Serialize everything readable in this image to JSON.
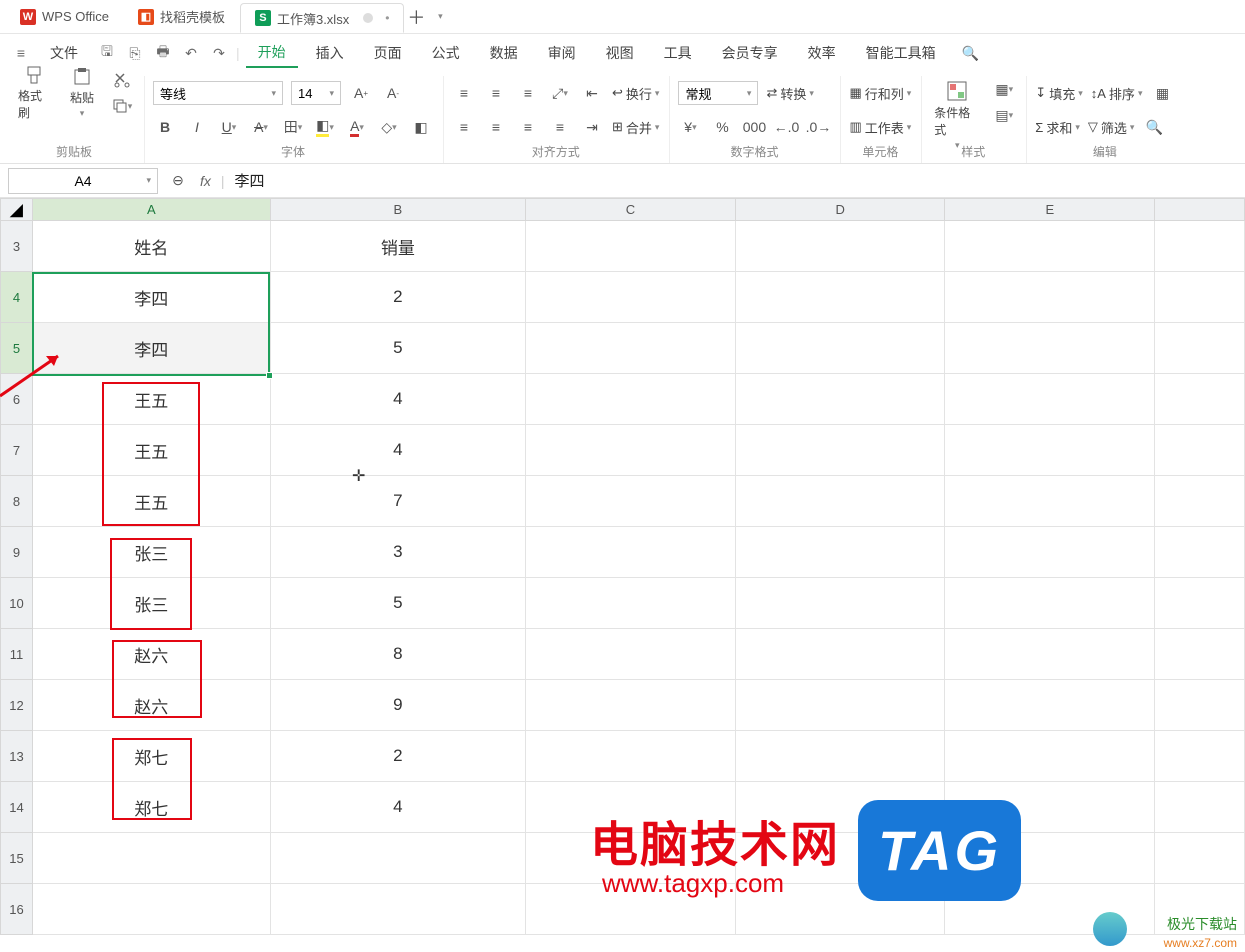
{
  "tabs": {
    "app": "WPS Office",
    "template": "找稻壳模板",
    "file": "工作簿3.xlsx",
    "new": "＋"
  },
  "menu": {
    "hamburger": "≡",
    "file": "文件",
    "items": [
      "开始",
      "插入",
      "页面",
      "公式",
      "数据",
      "审阅",
      "视图",
      "工具",
      "会员专享",
      "效率",
      "智能工具箱"
    ]
  },
  "ribbon": {
    "clipboard": {
      "formatpainter": "格式刷",
      "paste": "粘贴",
      "name": "剪贴板"
    },
    "font": {
      "name_sel": "等线",
      "size_sel": "14",
      "name": "字体"
    },
    "align": {
      "wrap": "换行",
      "merge": "合并",
      "name": "对齐方式"
    },
    "number": {
      "general": "常规",
      "convert": "转换",
      "name": "数字格式"
    },
    "cell": {
      "rowcol": "行和列",
      "sheet": "工作表",
      "name": "单元格"
    },
    "style": {
      "cond": "条件格式",
      "name": "样式"
    },
    "edit": {
      "fill": "填充",
      "sum": "求和",
      "sort": "排序",
      "filter": "筛选",
      "name": "编辑"
    }
  },
  "namebox": "A4",
  "fx": {
    "symbol": "fx",
    "value": "李四"
  },
  "columns": [
    "A",
    "B",
    "C",
    "D",
    "E"
  ],
  "rows": [
    {
      "n": "3",
      "a": "姓名",
      "b": "销量"
    },
    {
      "n": "4",
      "a": "李四",
      "b": "2"
    },
    {
      "n": "5",
      "a": "李四",
      "b": "5"
    },
    {
      "n": "6",
      "a": "王五",
      "b": "4"
    },
    {
      "n": "7",
      "a": "王五",
      "b": "4"
    },
    {
      "n": "8",
      "a": "王五",
      "b": "7"
    },
    {
      "n": "9",
      "a": "张三",
      "b": "3"
    },
    {
      "n": "10",
      "a": "张三",
      "b": "5"
    },
    {
      "n": "11",
      "a": "赵六",
      "b": "8"
    },
    {
      "n": "12",
      "a": "赵六",
      "b": "9"
    },
    {
      "n": "13",
      "a": "郑七",
      "b": "2"
    },
    {
      "n": "14",
      "a": "郑七",
      "b": "4"
    },
    {
      "n": "15",
      "a": "",
      "b": ""
    },
    {
      "n": "16",
      "a": "",
      "b": ""
    }
  ],
  "watermarks": {
    "tagxp_cn": "电脑技术网",
    "tagxp_url": "www.tagxp.com",
    "tag": "TAG",
    "jgxz": "极光下载站",
    "jgxz_url": "www.xz7.com"
  }
}
